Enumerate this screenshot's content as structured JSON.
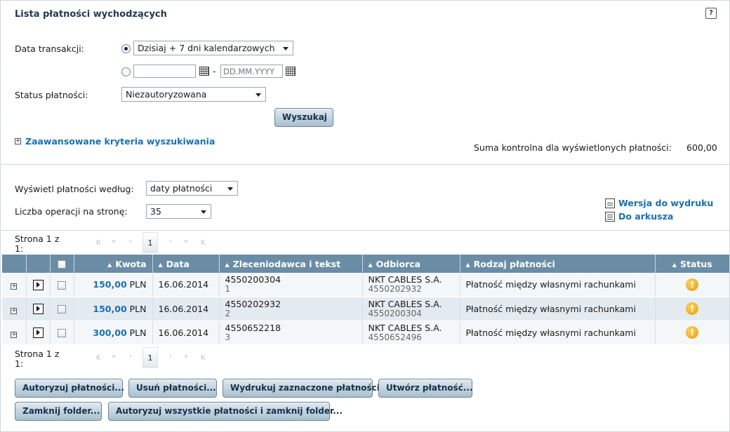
{
  "header": {
    "title": "Lista płatności wychodzących",
    "help_icon": "question-icon"
  },
  "filters": {
    "date_label": "Data transakcji:",
    "date_preset": "Dzisiaj + 7 dni kalendarzowych",
    "date_from_value": "",
    "date_to_placeholder": "DD.MM.YYYY",
    "date_separator": "-",
    "status_label": "Status płatności:",
    "status_value": "Niezautoryzowana",
    "search_button": "Wyszukaj",
    "advanced_toggle": "+",
    "advanced_label": "Zaawansowane kryteria wyszukiwania",
    "checksum_label": "Suma kontrolna dla wyświetlonych płatności:",
    "checksum_value": "600,00"
  },
  "view": {
    "sort_label": "Wyświetl płatności według:",
    "sort_value": "daty płatności",
    "per_page_label": "Liczba operacji na stronę:",
    "per_page_value": "35",
    "print_link": "Wersja do wydruku",
    "sheet_link": "Do arkusza"
  },
  "pager": {
    "label_line1": "Strona 1 z",
    "label_line2": "1:",
    "first": "K",
    "prev_fast": "«",
    "prev": "‹",
    "current": "1",
    "next": "›",
    "next_fast": "»",
    "last": "K"
  },
  "table": {
    "headers": {
      "amount": "Kwota",
      "date": "Data",
      "payer": "Zleceniodawca i tekst",
      "recipient": "Odbiorca",
      "type": "Rodzaj płatności",
      "status": "Status"
    },
    "rows": [
      {
        "amount": "150,00",
        "currency": "PLN",
        "date": "16.06.2014",
        "payer": "4550200304",
        "payer_text": "1",
        "recipient": "NKT CABLES S.A.",
        "recipient_account": "4550202932",
        "type": "Płatność między własnymi rachunkami",
        "status": "!"
      },
      {
        "amount": "150,00",
        "currency": "PLN",
        "date": "16.06.2014",
        "payer": "4550202932",
        "payer_text": "2",
        "recipient": "NKT CABLES S.A.",
        "recipient_account": "4550200304",
        "type": "Płatność między własnymi rachunkami",
        "status": "!"
      },
      {
        "amount": "300,00",
        "currency": "PLN",
        "date": "16.06.2014",
        "payer": "4550652218",
        "payer_text": "3",
        "recipient": "NKT CABLES S.A.",
        "recipient_account": "4550652496",
        "type": "Płatność między własnymi rachunkami",
        "status": "!"
      }
    ]
  },
  "actions": {
    "authorize": "Autoryzuj płatności...",
    "delete": "Usuń płatności...",
    "print_selected": "Wydrukuj zaznaczone płatności",
    "create": "Utwórz płatność...",
    "close_folder": "Zamknij folder...",
    "authorize_all_close": "Autoryzuj wszystkie płatności i zamknij folder..."
  },
  "colors": {
    "header_bg": "#6a8da5",
    "link": "#1b6fb0",
    "title": "#23384e",
    "warning": "#e59a0b"
  }
}
